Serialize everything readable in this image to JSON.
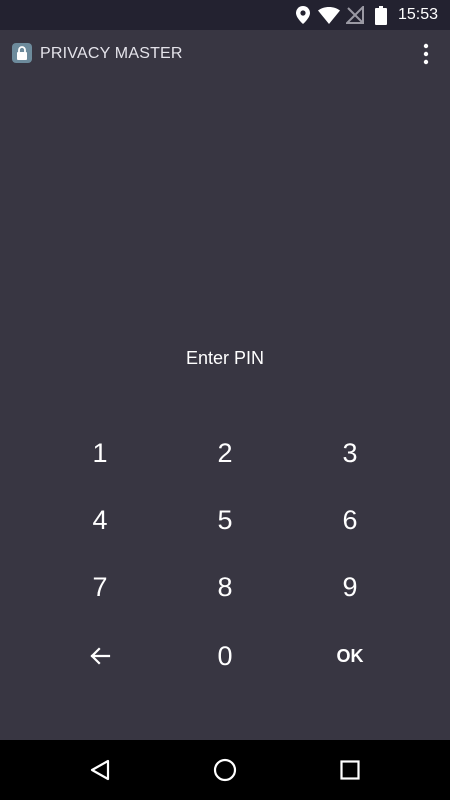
{
  "status_bar": {
    "time": "15:53",
    "icons": [
      "location-icon",
      "wifi-icon",
      "no-signal-icon",
      "battery-icon"
    ]
  },
  "app_bar": {
    "title": "PRIVACY MASTER",
    "logo_icon": "lock-icon",
    "menu_icon": "more-vert-icon"
  },
  "pin": {
    "prompt": "Enter PIN"
  },
  "keypad": {
    "keys": [
      "1",
      "2",
      "3",
      "4",
      "5",
      "6",
      "7",
      "8",
      "9",
      "",
      "0",
      "OK"
    ],
    "back_icon": "arrow-left-icon"
  },
  "nav_bar": {
    "icons": [
      "back-triangle-icon",
      "home-circle-icon",
      "recents-square-icon"
    ]
  },
  "colors": {
    "background": "#383642",
    "status_bar": "#232230",
    "text": "#ffffff",
    "logo": "#6d8b9c"
  }
}
